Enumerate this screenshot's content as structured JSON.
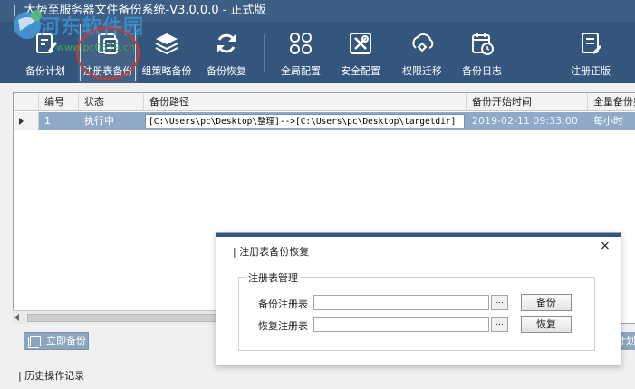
{
  "window": {
    "title": "大势至服务器文件备份系统-V3.0.0.0 - 正式版"
  },
  "watermark": {
    "title": "河东软件园",
    "url": "www.pc0359.cn"
  },
  "toolbar": {
    "items": [
      {
        "label": "备份计划",
        "icon": "edit-document-icon"
      },
      {
        "label": "注册表备份",
        "icon": "registry-book-icon"
      },
      {
        "label": "组策略备份",
        "icon": "stack-layers-icon"
      },
      {
        "label": "备份恢复",
        "icon": "refresh-icon"
      },
      {
        "label": "全局配置",
        "icon": "grid-icon"
      },
      {
        "label": "安全配置",
        "icon": "tools-icon"
      },
      {
        "label": "权限迁移",
        "icon": "transfer-icon"
      },
      {
        "label": "备份日志",
        "icon": "calendar-clock-icon"
      },
      {
        "label": "注册正版",
        "icon": "register-icon"
      }
    ],
    "selected_index": 1
  },
  "grid": {
    "columns": [
      "编号",
      "状态",
      "备份路径",
      "备份开始时间",
      "全量备份频"
    ],
    "rows": [
      {
        "id": "1",
        "status": "执行中",
        "path": "[C:\\Users\\pc\\Desktop\\整理]-->[C:\\Users\\pc\\Desktop\\targetdir]",
        "start_time": "2019-02-11 09:33:00",
        "frequency": "每小时"
      }
    ]
  },
  "buttons": {
    "backup_now": "立即备份",
    "plan_partial": "计划"
  },
  "history_link": "历史操作记录",
  "dialog": {
    "title": "注册表备份恢复",
    "group_label": "注册表管理",
    "backup_label": "备份注册表",
    "restore_label": "恢复注册表",
    "browse_label": "...",
    "backup_button": "备份",
    "restore_button": "恢复",
    "close_glyph": "×"
  },
  "colors": {
    "toolbar_bg": "#34557c",
    "titlebar_bg": "#3d5f86",
    "row_selected": "#8fa9c8"
  }
}
